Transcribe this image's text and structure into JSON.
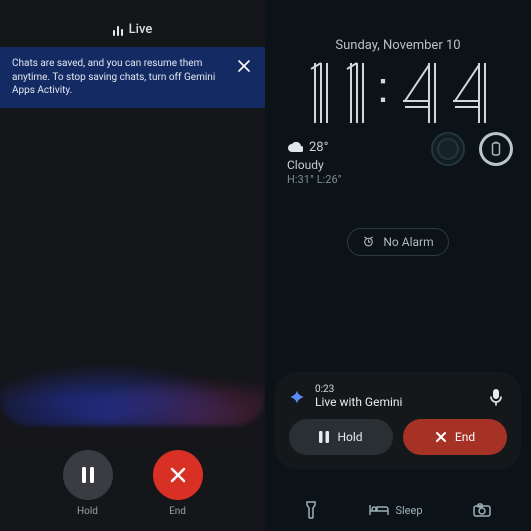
{
  "left": {
    "header_label": "Live",
    "banner_text": "Chats are saved, and you can resume them anytime. To stop saving chats, turn off Gemini Apps Activity.",
    "hold_label": "Hold",
    "end_label": "End"
  },
  "right": {
    "date": "Sunday, November 10",
    "time": "11:44",
    "weather": {
      "temp": "28°",
      "condition": "Cloudy",
      "hilo": "H:31° L:26°"
    },
    "alarm": "No Alarm",
    "media": {
      "elapsed": "0:23",
      "title": "Live with Gemini",
      "hold_label": "Hold",
      "end_label": "End"
    },
    "bottom": {
      "sleep_label": "Sleep"
    }
  },
  "colors": {
    "end_red": "#d93025",
    "banner_blue": "#142a63"
  }
}
